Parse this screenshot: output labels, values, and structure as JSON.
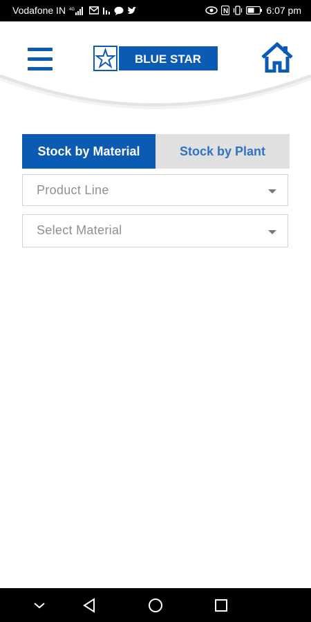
{
  "status_bar": {
    "carrier": "Vodafone IN",
    "time": "6:07 pm",
    "icons_left": [
      "signal-icon",
      "gmail-icon",
      "chart-icon",
      "message-icon",
      "twitter-icon"
    ],
    "icons_right": [
      "eye-icon",
      "nfc-icon",
      "vibrate-icon",
      "battery-icon"
    ]
  },
  "header": {
    "brand": "BLUE STAR",
    "brand_color": "#0b5bb5"
  },
  "tabs": [
    {
      "label": "Stock by Material",
      "active": true
    },
    {
      "label": "Stock by Plant",
      "active": false
    }
  ],
  "form": {
    "product_line_placeholder": "Product Line",
    "material_placeholder": "Select Material"
  },
  "colors": {
    "accent": "#0b5bb5",
    "tab_inactive_bg": "#e0e0e0",
    "tab_inactive_text": "#2f74c4",
    "placeholder": "#8f8f8f"
  }
}
